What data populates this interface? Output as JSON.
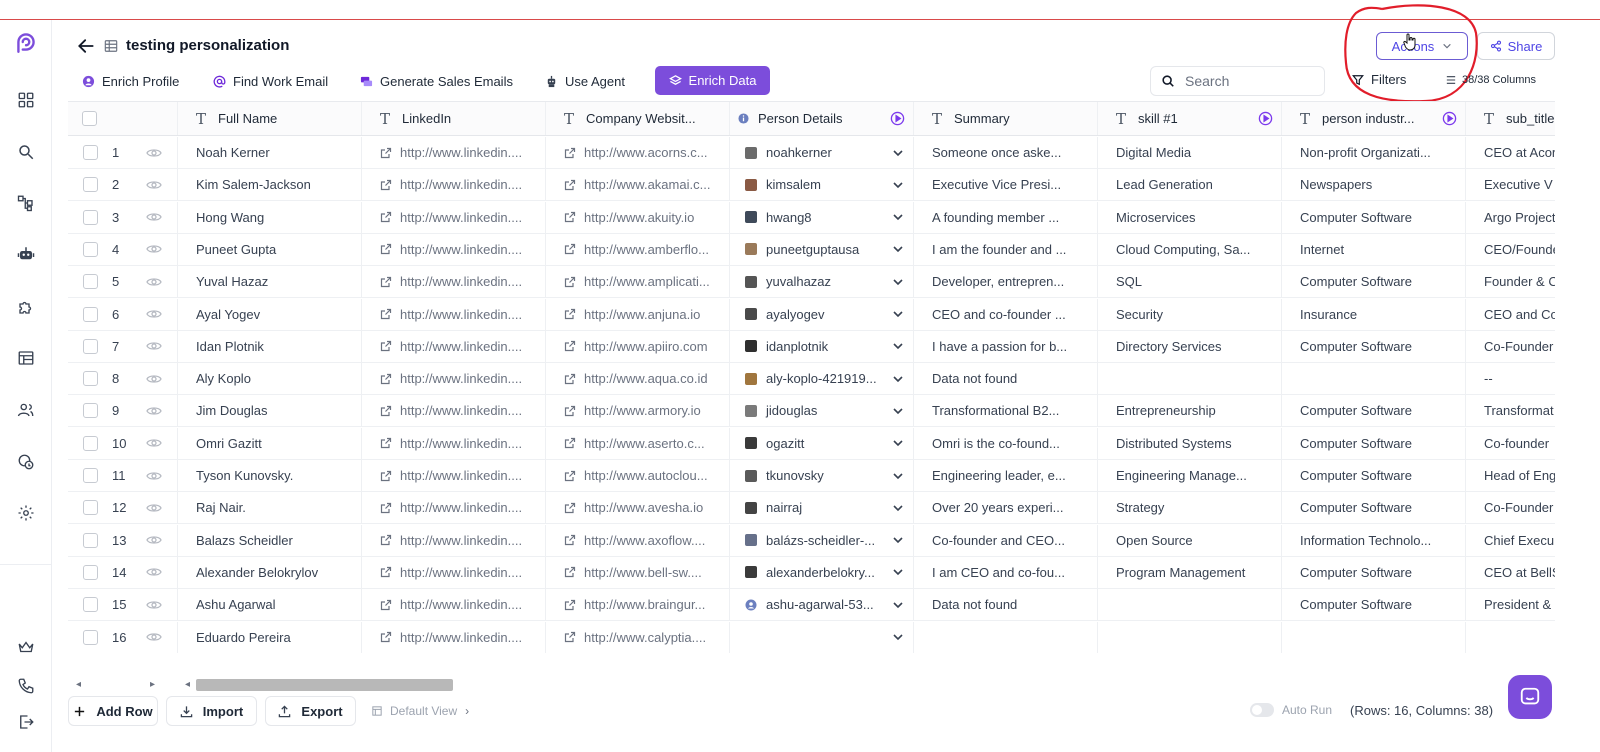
{
  "header": {
    "title": "testing personalization",
    "actions_label": "Actions",
    "share_label": "Share"
  },
  "toolbar": {
    "enrich_profile": "Enrich Profile",
    "find_work_email": "Find Work Email",
    "generate_sales_emails": "Generate Sales Emails",
    "use_agent": "Use Agent",
    "enrich_data": "Enrich Data",
    "search_placeholder": "Search",
    "filters": "Filters",
    "columns": "38/38 Columns"
  },
  "columns": [
    "Full Name",
    "LinkedIn",
    "Company Websit...",
    "Person Details",
    "Summary",
    "skill #1",
    "person industr...",
    "sub_title"
  ],
  "rows": [
    {
      "num": "1",
      "name": "Noah Kerner",
      "linkedin": "http://www.linkedin....",
      "website": "http://www.acorns.c...",
      "person": "noahkerner",
      "summary": "Someone once aske...",
      "skill": "Digital Media",
      "industry": "Non-profit Organizati...",
      "subtitle": "CEO at Acor"
    },
    {
      "num": "2",
      "name": "Kim Salem-Jackson",
      "linkedin": "http://www.linkedin....",
      "website": "http://www.akamai.c...",
      "person": "kimsalem",
      "summary": "Executive Vice Presi...",
      "skill": "Lead Generation",
      "industry": "Newspapers",
      "subtitle": "Executive V"
    },
    {
      "num": "3",
      "name": "Hong Wang",
      "linkedin": "http://www.linkedin....",
      "website": "http://www.akuity.io",
      "person": "hwang8",
      "summary": "A founding member ...",
      "skill": "Microservices",
      "industry": "Computer Software",
      "subtitle": "Argo Project"
    },
    {
      "num": "4",
      "name": "Puneet Gupta",
      "linkedin": "http://www.linkedin....",
      "website": "http://www.amberflo...",
      "person": "puneetguptausa",
      "summary": "I am the founder and ...",
      "skill": "Cloud Computing, Sa...",
      "industry": "Internet",
      "subtitle": "CEO/Founde"
    },
    {
      "num": "5",
      "name": "Yuval Hazaz",
      "linkedin": "http://www.linkedin....",
      "website": "http://www.amplicati...",
      "person": "yuvalhazaz",
      "summary": "Developer, entrepren...",
      "skill": "SQL",
      "industry": "Computer Software",
      "subtitle": "Founder & C"
    },
    {
      "num": "6",
      "name": "Ayal Yogev",
      "linkedin": "http://www.linkedin....",
      "website": "http://www.anjuna.io",
      "person": "ayalyogev",
      "summary": "CEO and co-founder ...",
      "skill": "Security",
      "industry": "Insurance",
      "subtitle": "CEO and Co"
    },
    {
      "num": "7",
      "name": "Idan Plotnik",
      "linkedin": "http://www.linkedin....",
      "website": "http://www.apiiro.com",
      "person": "idanplotnik",
      "summary": "I have a passion for b...",
      "skill": "Directory Services",
      "industry": "Computer Software",
      "subtitle": "Co-Founder"
    },
    {
      "num": "8",
      "name": "Aly Koplo",
      "linkedin": "http://www.linkedin....",
      "website": "http://www.aqua.co.id",
      "person": "aly-koplo-421919...",
      "summary": "Data not found",
      "skill": "",
      "industry": "",
      "subtitle": "--"
    },
    {
      "num": "9",
      "name": "Jim Douglas",
      "linkedin": "http://www.linkedin....",
      "website": "http://www.armory.io",
      "person": "jidouglas",
      "summary": "Transformational B2...",
      "skill": "Entrepreneurship",
      "industry": "Computer Software",
      "subtitle": "Transformat"
    },
    {
      "num": "10",
      "name": "Omri Gazitt",
      "linkedin": "http://www.linkedin....",
      "website": "http://www.aserto.c...",
      "person": "ogazitt",
      "summary": "Omri is the co-found...",
      "skill": "Distributed Systems",
      "industry": "Computer Software",
      "subtitle": "Co-founder"
    },
    {
      "num": "11",
      "name": "Tyson Kunovsky.",
      "linkedin": "http://www.linkedin....",
      "website": "http://www.autoclou...",
      "person": "tkunovsky",
      "summary": "Engineering leader, e...",
      "skill": "Engineering Manage...",
      "industry": "Computer Software",
      "subtitle": "Head of Eng"
    },
    {
      "num": "12",
      "name": "Raj Nair.",
      "linkedin": "http://www.linkedin....",
      "website": "http://www.avesha.io",
      "person": "nairraj",
      "summary": "Over 20 years experi...",
      "skill": "Strategy",
      "industry": "Computer Software",
      "subtitle": "Co-Founder"
    },
    {
      "num": "13",
      "name": "Balazs Scheidler",
      "linkedin": "http://www.linkedin....",
      "website": "http://www.axoflow....",
      "person": "balázs-scheidler-...",
      "summary": "Co-founder and CEO...",
      "skill": "Open Source",
      "industry": "Information Technolo...",
      "subtitle": "Chief Execu"
    },
    {
      "num": "14",
      "name": "Alexander Belokrylov",
      "linkedin": "http://www.linkedin....",
      "website": "http://www.bell-sw....",
      "person": "alexanderbelokry...",
      "summary": "I am CEO and co-fou...",
      "skill": "Program Management",
      "industry": "Computer Software",
      "subtitle": "CEO at BellS"
    },
    {
      "num": "15",
      "name": "Ashu Agarwal",
      "linkedin": "http://www.linkedin....",
      "website": "http://www.braingur...",
      "person": "ashu-agarwal-53...",
      "summary": "Data not found",
      "skill": "",
      "industry": "Computer Software",
      "subtitle": "President &"
    },
    {
      "num": "16",
      "name": "Eduardo Pereira",
      "linkedin": "http://www.linkedin....",
      "website": "http://www.calyptia....",
      "person": "",
      "summary": "",
      "skill": "",
      "industry": "",
      "subtitle": ""
    }
  ],
  "footer": {
    "add_row": "Add Row",
    "import": "Import",
    "export": "Export",
    "default_view": "Default View",
    "auto_run": "Auto Run",
    "row_count": "(Rows: 16, Columns: 38)"
  },
  "colors": {
    "accent": "#7c4ddb",
    "annotation": "#e11d2a"
  }
}
